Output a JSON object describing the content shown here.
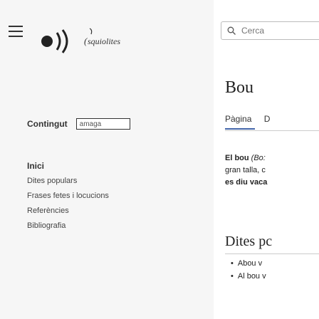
{
  "header": {
    "menu_icon": "hamburger-menu-icon",
    "logo_text": "(( esquiolites",
    "search": {
      "placeholder": "Cerca"
    }
  },
  "content_selector": {
    "label": "Contingut",
    "value": "amaga"
  },
  "nav": {
    "heading": "Inici",
    "items": [
      {
        "label": "Dites populars"
      },
      {
        "label": "Frases fetes i locucions"
      },
      {
        "label": "Referències"
      },
      {
        "label": "Bibliografia"
      }
    ]
  },
  "article": {
    "title": "Bou",
    "tabs": [
      {
        "label": "Pàgina"
      },
      {
        "label": "D"
      }
    ],
    "intro": {
      "term": "El bou",
      "paren": "(Bo:",
      "line2": "gran talla, c",
      "line3": "es diu vaca"
    },
    "section_title": "Dites pc",
    "bullets": [
      {
        "text": "Abou v"
      },
      {
        "text": "Al bou v"
      }
    ]
  },
  "colors": {
    "tab_accent": "#4466aa"
  }
}
